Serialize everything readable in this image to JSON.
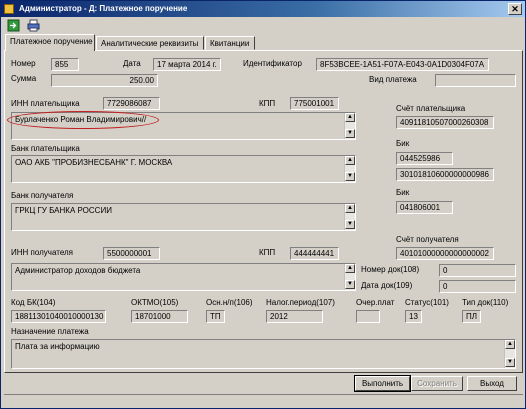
{
  "window": {
    "title": "Администратор - Д: Платежное поручение",
    "close": "✕"
  },
  "tabs": [
    {
      "label": "Платежное поручение"
    },
    {
      "label": "Аналитические реквизиты"
    },
    {
      "label": "Квитанции"
    }
  ],
  "header": {
    "number_label": "Номер",
    "number": "855",
    "date_label": "Дата",
    "date": "17 марта 2014 г.",
    "id_label": "Идентификатор",
    "id": "8F53BCEE-1A51-F07A-E043-0A1D0304F07A",
    "sum_label": "Сумма",
    "sum": "250.00",
    "pay_type_label": "Вид платежа",
    "pay_type": ""
  },
  "payer": {
    "inn_label": "ИНН плательщика",
    "inn": "7729086087",
    "kpp_label": "КПП",
    "kpp": "775001001",
    "name": "Бурлаченко Роман Владимирович//",
    "account_label": "Счёт плательщика",
    "account": "40911810507000260308"
  },
  "payer_bank": {
    "label": "Банк плательщика",
    "name": "ОАО АКБ \"ПРОБИЗНЕСБАНК\" Г. МОСКВА",
    "bik_label": "Бик",
    "bik": "044525986",
    "corr": "30101810600000000986"
  },
  "payee_bank": {
    "label": "Банк получателя",
    "name": "ГРКЦ ГУ БАНКА РОССИИ",
    "bik_label": "Бик",
    "bik": "041806001"
  },
  "payee": {
    "inn_label": "ИНН получателя",
    "inn": "5500000001",
    "kpp_label": "КПП",
    "kpp": "444444441",
    "account_label": "Счёт получателя",
    "account": "40101000000000000002",
    "name": "Администратор доходов бюджета",
    "doc_num_label": "Номер док(108)",
    "doc_num": "0",
    "doc_date_label": "Дата док(109)",
    "doc_date": "0"
  },
  "budget": {
    "kbk_label": "Код БК(104)",
    "kbk": "18811301040010000130",
    "oktmo_label": "ОКТМО(105)",
    "oktmo": "18701000",
    "basis_label": "Осн.н/п(106)",
    "basis": "ТП",
    "period_label": "Налог.период(107)",
    "period": "2012",
    "queue_label": "Очер.плат",
    "queue": "",
    "status_label": "Статус(101)",
    "status": "13",
    "doc_type_label": "Тип док(110)",
    "doc_type": "ПЛ"
  },
  "purpose": {
    "label": "Назначение платежа",
    "text": "Плата за информацию"
  },
  "buttons": {
    "execute": "Выполнить",
    "save": "Сохранить",
    "exit": "Выход"
  },
  "colors": {
    "title_start": "#0a246a",
    "title_end": "#a6caf0",
    "highlight": "#c02020"
  }
}
